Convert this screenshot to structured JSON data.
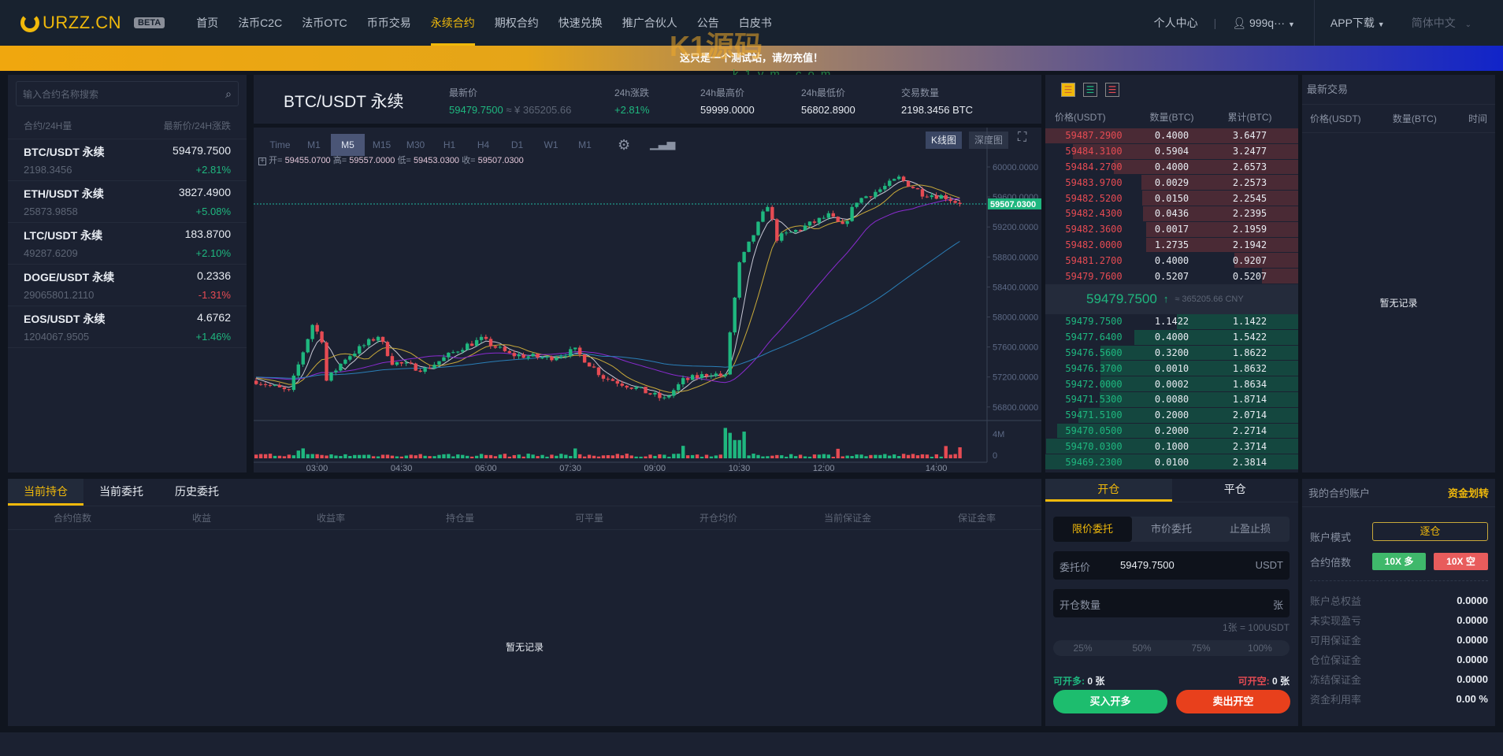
{
  "header": {
    "logo": "URZZ.CN",
    "beta": "BETA",
    "nav": [
      "首页",
      "法币C2C",
      "法币OTC",
      "币币交易",
      "永续合约",
      "期权合约",
      "快速兑换",
      "推广合伙人",
      "公告",
      "白皮书"
    ],
    "active_nav": 4,
    "user_center": "个人中心",
    "username": "999q···",
    "app_download": "APP下载",
    "language": "简体中文"
  },
  "banner": {
    "text": "这只是一个测试站，请勿充值！"
  },
  "watermark": {
    "text": "K1源码",
    "url": "k1ym.com"
  },
  "market_list": {
    "search_placeholder": "输入合约名称搜索",
    "col_left": "合约/24H量",
    "col_right": "最新价/24H涨跌",
    "items": [
      {
        "name": "BTC/USDT 永续",
        "volume": "2198.3456",
        "price": "59479.7500",
        "change": "+2.81%",
        "dir": "up"
      },
      {
        "name": "ETH/USDT 永续",
        "volume": "25873.9858",
        "price": "3827.4900",
        "change": "+5.08%",
        "dir": "up"
      },
      {
        "name": "LTC/USDT 永续",
        "volume": "49287.6209",
        "price": "183.8700",
        "change": "+2.10%",
        "dir": "up"
      },
      {
        "name": "DOGE/USDT 永续",
        "volume": "29065801.2110",
        "price": "0.2336",
        "change": "-1.31%",
        "dir": "dn"
      },
      {
        "name": "EOS/USDT 永续",
        "volume": "1204067.9505",
        "price": "4.6762",
        "change": "+1.46%",
        "dir": "up"
      }
    ]
  },
  "ticker": {
    "symbol": "BTC/USDT 永续",
    "last_label": "最新价",
    "last": "59479.7500",
    "last_cny": "≈ ¥ 365205.66",
    "change_label": "24h涨跌",
    "change": "+2.81%",
    "high_label": "24h最高价",
    "high": "59999.0000",
    "low_label": "24h最低价",
    "low": "56802.8900",
    "vol_label": "交易数量",
    "vol": "2198.3456 BTC"
  },
  "chart": {
    "intervals": [
      "Time",
      "M1",
      "M5",
      "M15",
      "M30",
      "H1",
      "H4",
      "D1",
      "W1",
      "M1"
    ],
    "active_interval": 2,
    "kline_label": "K线图",
    "depth_label": "深度图",
    "ohlc": {
      "open_label": "开=",
      "open": "59455.0700",
      "high_label": "高=",
      "high": "59557.0000",
      "low_label": "低=",
      "low": "59453.0300",
      "close_label": "收=",
      "close": "59507.0300"
    }
  },
  "chart_data": {
    "type": "candlestick",
    "interval": "M5",
    "grid": false,
    "price_ticks": [
      "60000.0000",
      "59600.0000",
      "59200.0000",
      "58800.0000",
      "58400.0000",
      "58000.0000",
      "57600.0000",
      "57200.0000",
      "56800.0000"
    ],
    "price_range": [
      56800,
      60000
    ],
    "time_ticks": [
      "03:00",
      "04:30",
      "06:00",
      "07:30",
      "09:00",
      "10:30",
      "12:00",
      "14:00"
    ],
    "volume_ticks": [
      "4M",
      "0"
    ],
    "last_price": "59507.0300",
    "ma_colors": [
      "#c9c9d6",
      "#c8a93a",
      "#8a2bd0",
      "#2a7fb8"
    ],
    "up_color": "#1fb77f",
    "down_color": "#e64b53",
    "price_path": [
      [
        "01:55",
        57150
      ],
      [
        "02:30",
        57000
      ],
      [
        "02:55",
        57900
      ],
      [
        "03:05",
        57700
      ],
      [
        "03:10",
        57150
      ],
      [
        "03:30",
        57450
      ],
      [
        "04:05",
        57750
      ],
      [
        "04:20",
        57400
      ],
      [
        "04:55",
        57300
      ],
      [
        "05:35",
        57600
      ],
      [
        "05:55",
        57700
      ],
      [
        "06:25",
        57500
      ],
      [
        "07:05",
        57450
      ],
      [
        "07:35",
        57550
      ],
      [
        "08:05",
        57200
      ],
      [
        "08:40",
        57050
      ],
      [
        "09:10",
        56900
      ],
      [
        "09:30",
        57150
      ],
      [
        "10:00",
        57250
      ],
      [
        "10:15",
        57200
      ],
      [
        "10:20",
        57800
      ],
      [
        "10:30",
        58700
      ],
      [
        "10:45",
        59100
      ],
      [
        "11:00",
        59500
      ],
      [
        "11:10",
        59050
      ],
      [
        "11:30",
        59150
      ],
      [
        "12:05",
        59350
      ],
      [
        "12:20",
        59200
      ],
      [
        "12:35",
        59550
      ],
      [
        "13:00",
        59700
      ],
      [
        "13:20",
        59850
      ],
      [
        "13:45",
        59650
      ],
      [
        "14:10",
        59600
      ],
      [
        "14:25",
        59507
      ]
    ]
  },
  "orderbook": {
    "col_price": "价格(USDT)",
    "col_amount": "数量(BTC)",
    "col_total": "累计(BTC)",
    "asks": [
      [
        "59487.2900",
        "0.4000",
        "3.6477"
      ],
      [
        "59484.3100",
        "0.5904",
        "3.2477"
      ],
      [
        "59484.2700",
        "0.4000",
        "2.6573"
      ],
      [
        "59483.9700",
        "0.0029",
        "2.2573"
      ],
      [
        "59482.5200",
        "0.0150",
        "2.2545"
      ],
      [
        "59482.4300",
        "0.0436",
        "2.2395"
      ],
      [
        "59482.3600",
        "0.0017",
        "2.1959"
      ],
      [
        "59482.0000",
        "1.2735",
        "2.1942"
      ],
      [
        "59481.2700",
        "0.4000",
        "0.9207"
      ],
      [
        "59479.7600",
        "0.5207",
        "0.5207"
      ]
    ],
    "mid_price": "59479.7500",
    "mid_arrow": "↑",
    "mid_cny": "≈ 365205.66 CNY",
    "bids": [
      [
        "59479.7500",
        "1.1422",
        "1.1422"
      ],
      [
        "59477.6400",
        "0.4000",
        "1.5422"
      ],
      [
        "59476.5600",
        "0.3200",
        "1.8622"
      ],
      [
        "59476.3700",
        "0.0010",
        "1.8632"
      ],
      [
        "59472.0000",
        "0.0002",
        "1.8634"
      ],
      [
        "59471.5300",
        "0.0080",
        "1.8714"
      ],
      [
        "59471.5100",
        "0.2000",
        "2.0714"
      ],
      [
        "59470.0500",
        "0.2000",
        "2.2714"
      ],
      [
        "59470.0300",
        "0.1000",
        "2.3714"
      ],
      [
        "59469.2300",
        "0.0100",
        "2.3814"
      ]
    ]
  },
  "trades": {
    "title": "最新交易",
    "col_price": "价格(USDT)",
    "col_amount": "数量(BTC)",
    "col_time": "时间",
    "empty": "暂无记录"
  },
  "positions": {
    "tabs": [
      "当前持仓",
      "当前委托",
      "历史委托"
    ],
    "columns": [
      "合约倍数",
      "收益",
      "收益率",
      "持仓量",
      "可平量",
      "开仓均价",
      "当前保证金",
      "保证金率"
    ],
    "empty": "暂无记录"
  },
  "trade_form": {
    "tabs": [
      "开仓",
      "平仓"
    ],
    "order_types": [
      "限价委托",
      "市价委托",
      "止盈止损"
    ],
    "price_label": "委托价",
    "price": "59479.7500",
    "price_unit": "USDT",
    "qty_placeholder": "开仓数量",
    "qty_unit": "张",
    "contract_note": "1张 = 100USDT",
    "percents": [
      "25%",
      "50%",
      "75%",
      "100%"
    ],
    "can_long_label": "可开多:",
    "can_long": "0 张",
    "can_short_label": "可开空:",
    "can_short": "0 张",
    "buy_label": "买入开多",
    "sell_label": "卖出开空"
  },
  "account": {
    "title": "我的合约账户",
    "transfer": "资金划转",
    "mode_label": "账户模式",
    "mode": "逐仓",
    "leverage_label": "合约倍数",
    "long_lev": "10X 多",
    "short_lev": "10X 空",
    "rows": [
      [
        "账户总权益",
        "0.0000"
      ],
      [
        "未实现盈亏",
        "0.0000"
      ],
      [
        "可用保证金",
        "0.0000"
      ],
      [
        "仓位保证金",
        "0.0000"
      ],
      [
        "冻结保证金",
        "0.0000"
      ],
      [
        "资金利用率",
        "0.00 %"
      ]
    ]
  },
  "colors": {
    "accent": "#f0b90b",
    "up": "#1fb77f",
    "down": "#e64b53",
    "bg": "#10151f",
    "panel": "#1b2131"
  }
}
